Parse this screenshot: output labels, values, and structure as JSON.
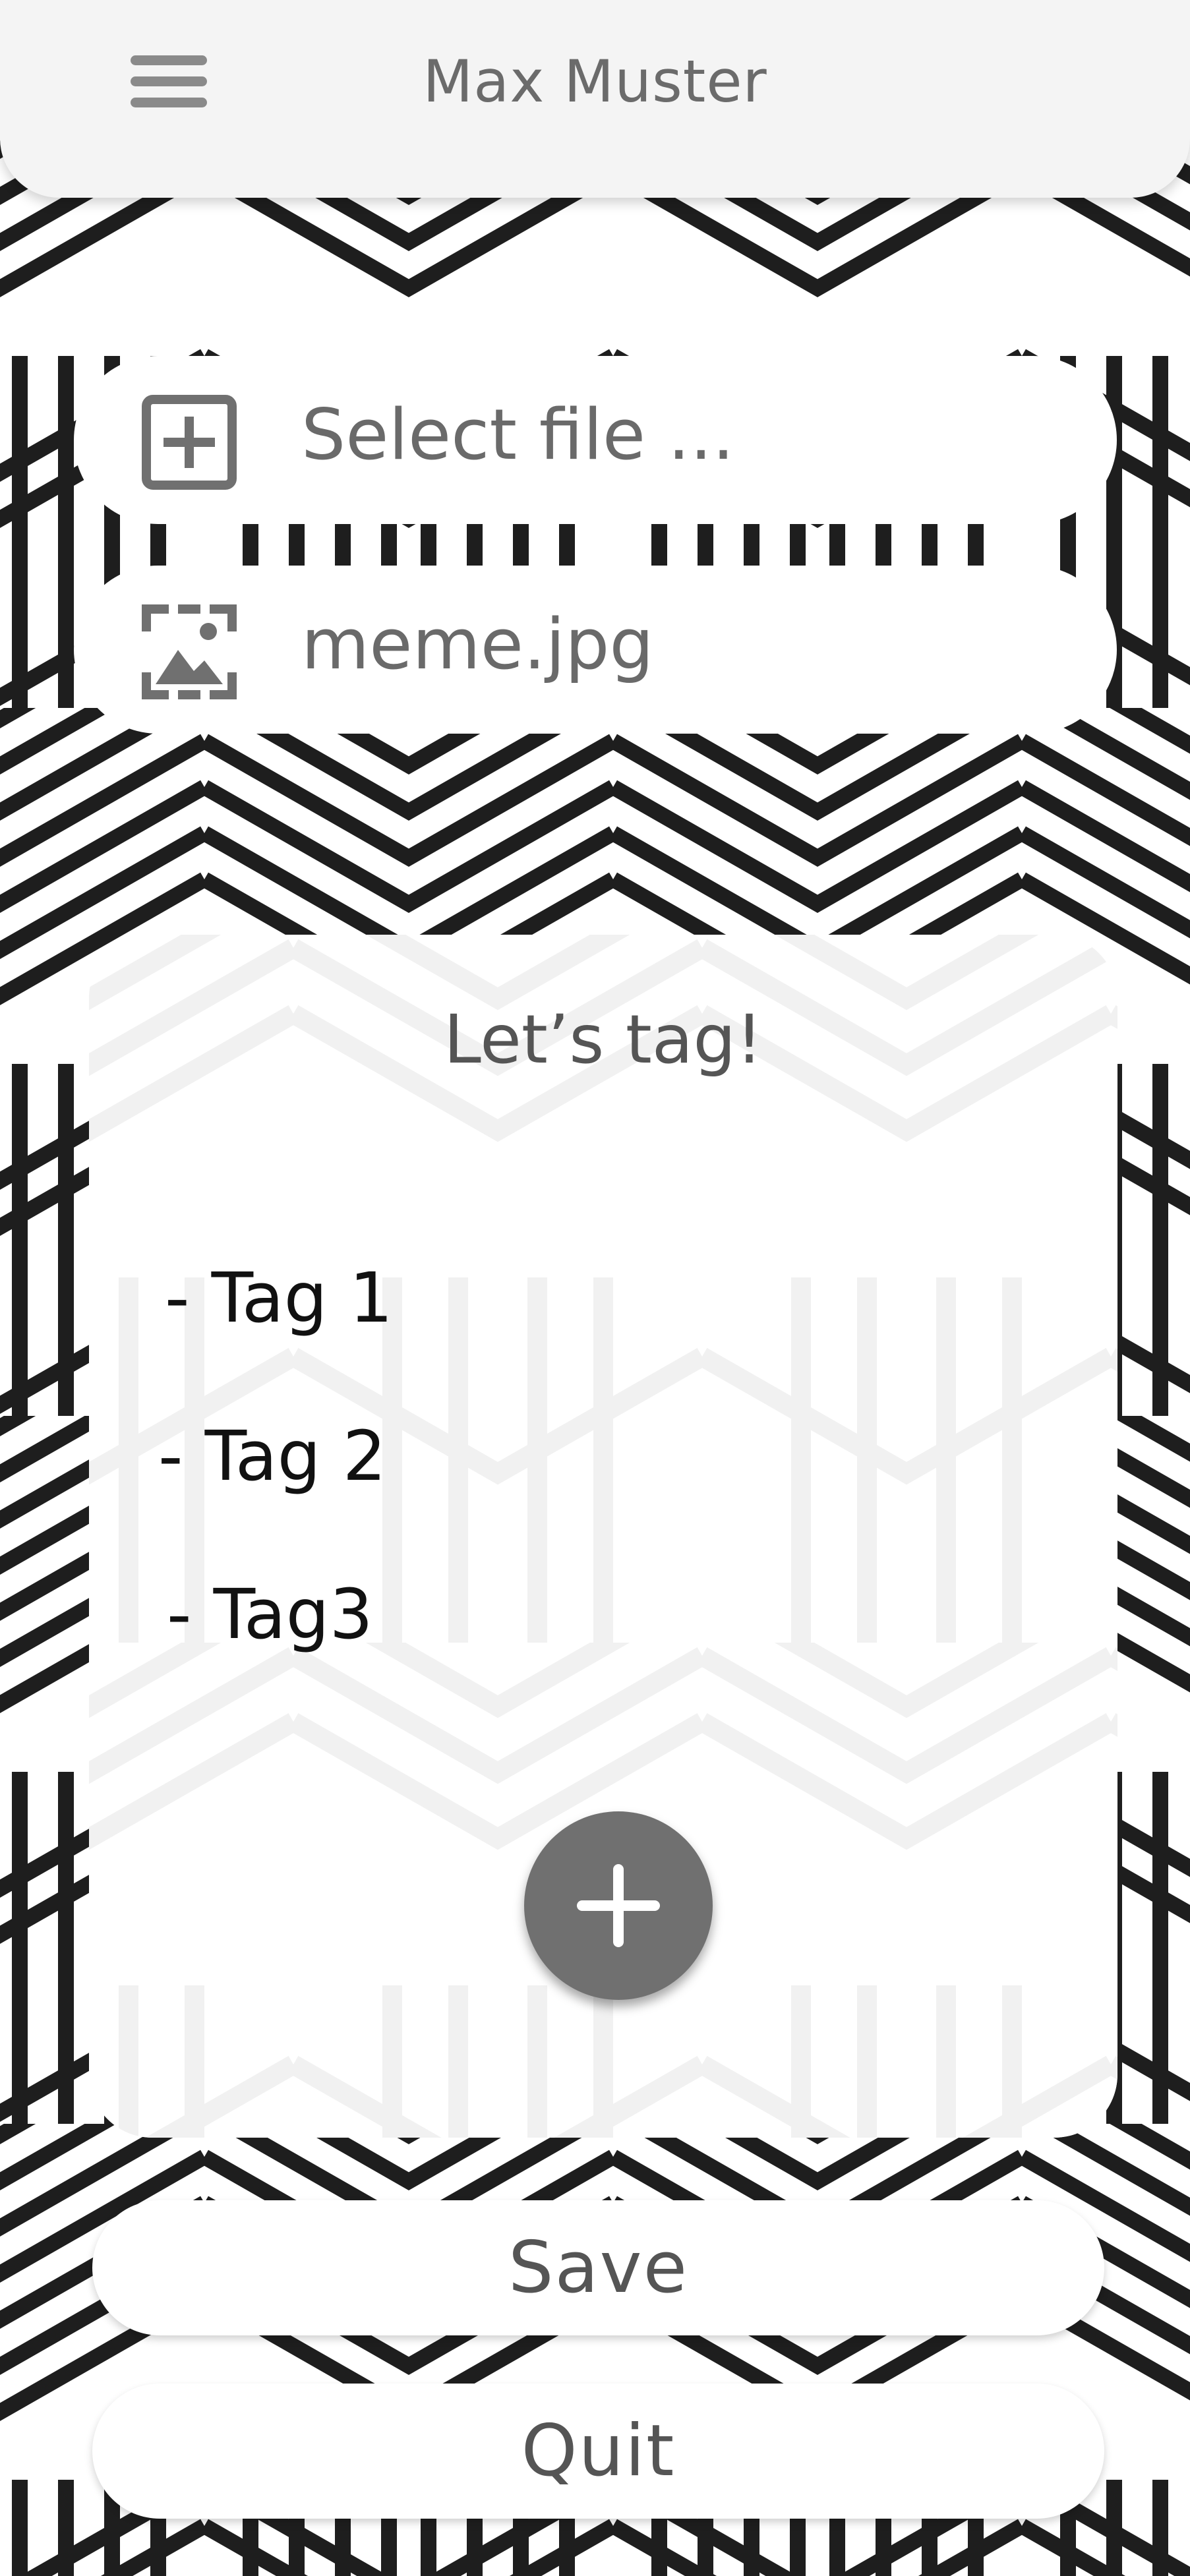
{
  "header": {
    "title": "Max Muster",
    "menu_icon": "hamburger-menu-icon"
  },
  "file_picker": {
    "select_label": "Select file ...",
    "select_icon": "plus-square-icon",
    "file_name": "meme.jpg",
    "file_icon": "image-icon"
  },
  "tag_card": {
    "title": "Let’s tag!",
    "tags": [
      "- Tag 1",
      "- Tag 2",
      "- Tag3"
    ],
    "add_icon": "plus-icon"
  },
  "actions": {
    "save_label": "Save",
    "quit_label": "Quit"
  },
  "colors": {
    "pattern": "#1e1e1e",
    "icon": "#707070",
    "text": "#555555",
    "header_bg": "#f4f4f4"
  }
}
